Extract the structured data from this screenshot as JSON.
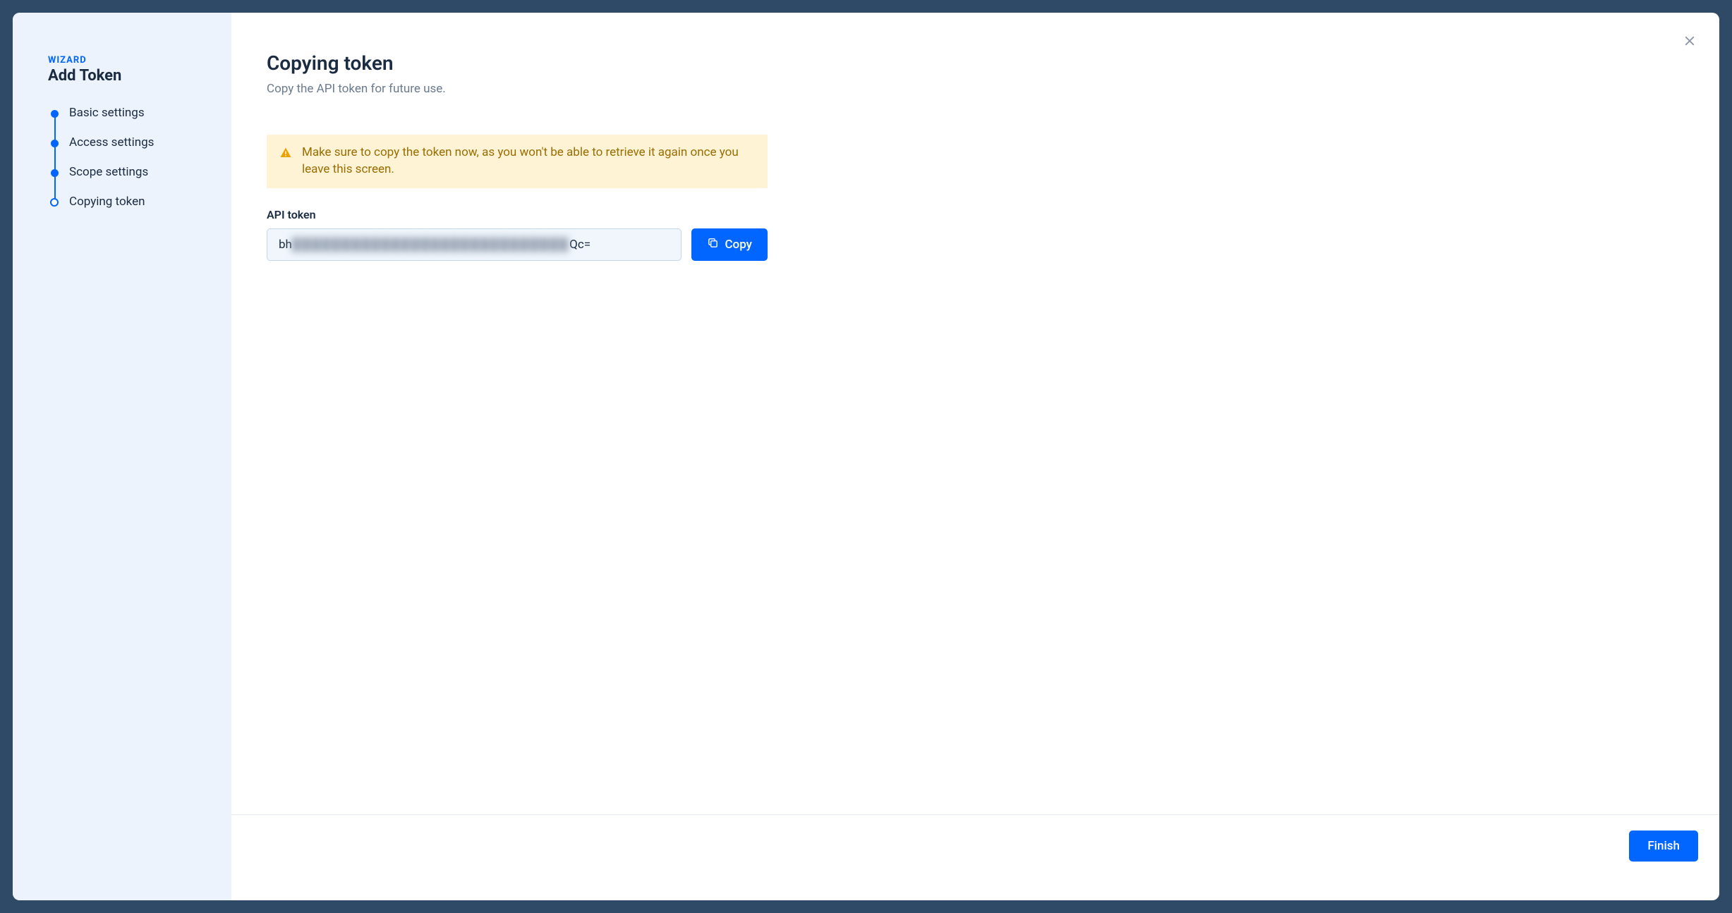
{
  "sidebar": {
    "wizard_label": "WIZARD",
    "wizard_title": "Add Token",
    "steps": [
      {
        "label": "Basic settings",
        "state": "done"
      },
      {
        "label": "Access settings",
        "state": "done"
      },
      {
        "label": "Scope settings",
        "state": "done"
      },
      {
        "label": "Copying token",
        "state": "current"
      }
    ]
  },
  "content": {
    "title": "Copying token",
    "subtitle": "Copy the API token for future use.",
    "alert_text": "Make sure to copy the token now, as you won't be able to retrieve it again once you leave this screen.",
    "field_label": "API token",
    "token_prefix": "bh",
    "token_obscured": "████████████████████████████",
    "token_suffix": "Qc=",
    "copy_button": "Copy",
    "finish_button": "Finish"
  }
}
